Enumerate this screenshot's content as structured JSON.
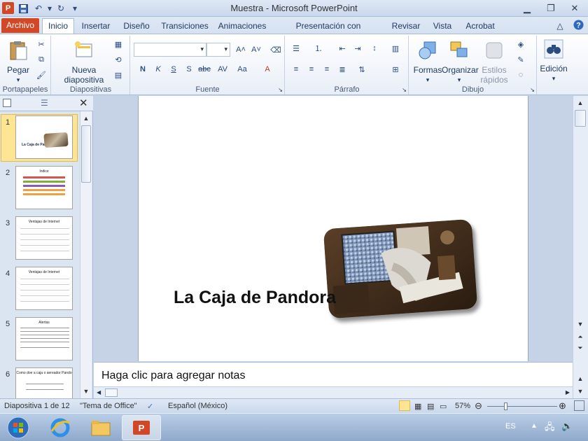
{
  "window": {
    "title": "Muestra - Microsoft PowerPoint"
  },
  "tabs": [
    "Archivo",
    "Inicio",
    "Insertar",
    "Diseño",
    "Transiciones",
    "Animaciones",
    "Presentación con diapositivas",
    "Revisar",
    "Vista",
    "Acrobat"
  ],
  "ribbon": {
    "groups": {
      "portapapeles": "Portapapeles",
      "diapositivas": "Diapositivas",
      "fuente": "Fuente",
      "parrafo": "Párrafo",
      "dibujo": "Dibujo"
    },
    "buttons": {
      "pegar": "Pegar",
      "nueva_1": "Nueva",
      "nueva_2": "diapositiva",
      "formas": "Formas",
      "organizar": "Organizar",
      "estilos_1": "Estilos",
      "estilos_2": "rápidos",
      "edicion": "Edición"
    }
  },
  "thumbnails": [
    {
      "num": "1",
      "title": "La Caja de Pandora"
    },
    {
      "num": "2",
      "title": "Indice"
    },
    {
      "num": "3",
      "title": "Ventajas de Internet"
    },
    {
      "num": "4",
      "title": "Ventajas de Internet"
    },
    {
      "num": "5",
      "title": "Alertas"
    },
    {
      "num": "6",
      "title": "Como doe a caja o aereador Pando"
    }
  ],
  "slide": {
    "title": "La Caja de Pandora"
  },
  "notes": {
    "placeholder": "Haga clic para agregar notas"
  },
  "status": {
    "slide": "Diapositiva 1 de 12",
    "theme": "\"Tema de Office\"",
    "language": "Español (México)",
    "zoom": "57%"
  },
  "taskbar": {
    "lang": "ES"
  },
  "colors": {
    "file_tab": "#d24726",
    "selection": "#fde594"
  }
}
